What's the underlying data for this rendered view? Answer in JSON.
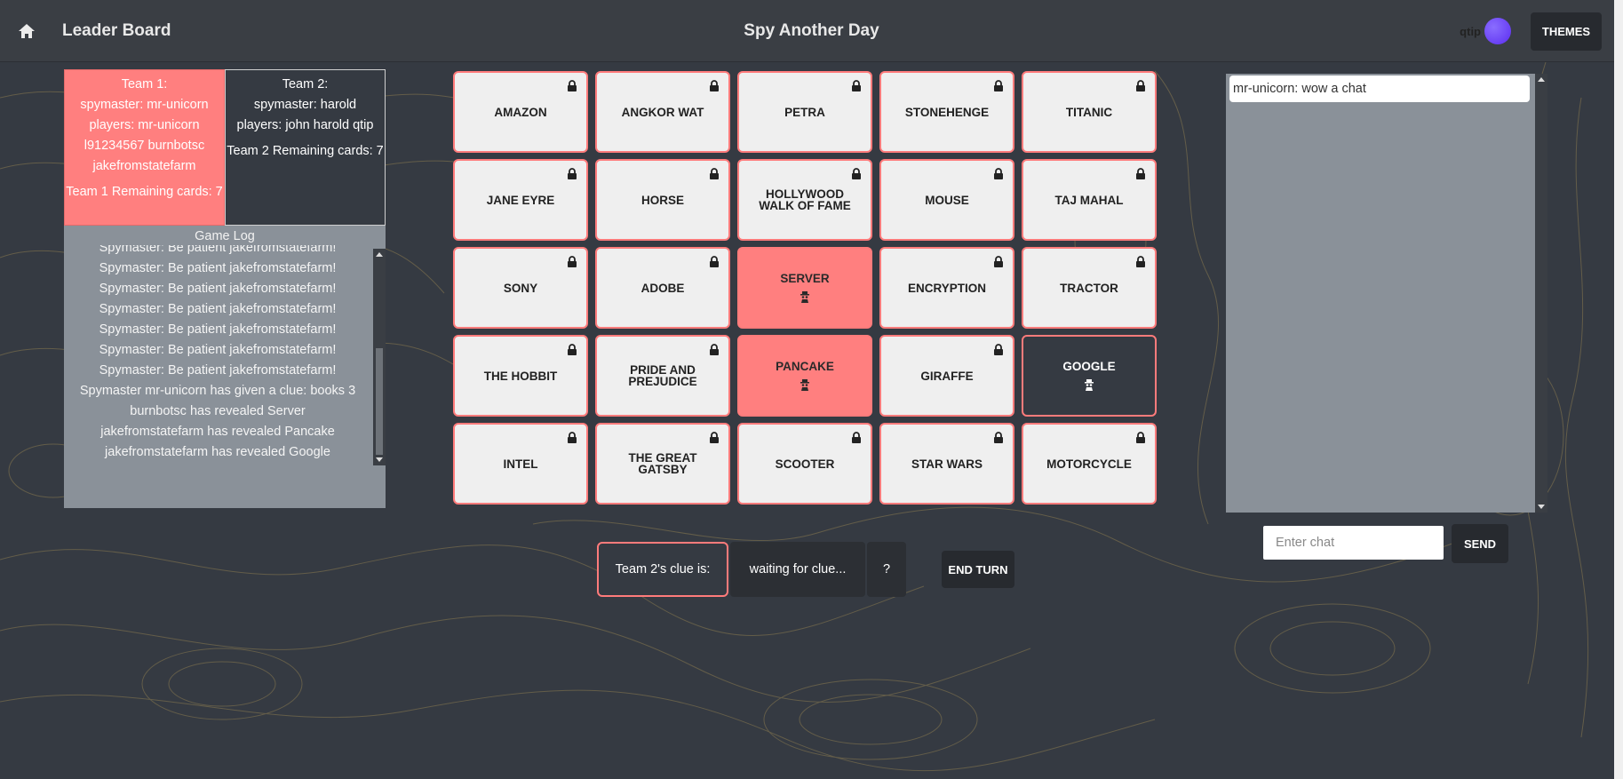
{
  "header": {
    "leader_board": "Leader Board",
    "title": "Spy Another Day",
    "username": "qtip",
    "themes_label": "THEMES"
  },
  "teams": {
    "team1": {
      "name": "Team 1:",
      "spymaster": "spymaster: mr-unicorn",
      "players": "players: mr-unicorn l91234567  burnbotsc jakefromstatefarm",
      "remaining": "Team 1 Remaining cards: 7"
    },
    "team2": {
      "name": "Team 2:",
      "spymaster": "spymaster: harold",
      "players": "players: john  harold qtip",
      "remaining": "Team 2 Remaining cards: 7"
    }
  },
  "game_log": {
    "title": "Game Log",
    "entries": [
      "Spymaster: Be patient jakefromstatefarm!",
      "Spymaster: Be patient jakefromstatefarm!",
      "Spymaster: Be patient jakefromstatefarm!",
      "Spymaster: Be patient jakefromstatefarm!",
      "Spymaster: Be patient jakefromstatefarm!",
      "Spymaster: Be patient jakefromstatefarm!",
      "Spymaster: Be patient jakefromstatefarm!",
      "Spymaster mr-unicorn has given a clue: books 3",
      "burnbotsc has revealed Server",
      "jakefromstatefarm has revealed Pancake",
      "jakefromstatefarm has revealed Google"
    ]
  },
  "board": {
    "cards": [
      {
        "word": "AMAZON",
        "state": "hidden"
      },
      {
        "word": "ANGKOR WAT",
        "state": "hidden"
      },
      {
        "word": "PETRA",
        "state": "hidden"
      },
      {
        "word": "STONEHENGE",
        "state": "hidden"
      },
      {
        "word": "TITANIC",
        "state": "hidden"
      },
      {
        "word": "JANE EYRE",
        "state": "hidden"
      },
      {
        "word": "HORSE",
        "state": "hidden"
      },
      {
        "word": "HOLLYWOOD WALK OF FAME",
        "state": "hidden"
      },
      {
        "word": "MOUSE",
        "state": "hidden"
      },
      {
        "word": "TAJ MAHAL",
        "state": "hidden"
      },
      {
        "word": "SONY",
        "state": "hidden"
      },
      {
        "word": "ADOBE",
        "state": "hidden"
      },
      {
        "word": "SERVER",
        "state": "red"
      },
      {
        "word": "ENCRYPTION",
        "state": "hidden"
      },
      {
        "word": "TRACTOR",
        "state": "hidden"
      },
      {
        "word": "THE HOBBIT",
        "state": "hidden"
      },
      {
        "word": "PRIDE AND PREJUDICE",
        "state": "hidden"
      },
      {
        "word": "PANCAKE",
        "state": "red"
      },
      {
        "word": "GIRAFFE",
        "state": "hidden"
      },
      {
        "word": "GOOGLE",
        "state": "blue"
      },
      {
        "word": "INTEL",
        "state": "hidden"
      },
      {
        "word": "THE GREAT GATSBY",
        "state": "hidden"
      },
      {
        "word": "SCOOTER",
        "state": "hidden"
      },
      {
        "word": "STAR WARS",
        "state": "hidden"
      },
      {
        "word": "MOTORCYCLE",
        "state": "hidden"
      }
    ]
  },
  "clue": {
    "label": "Team 2's clue is:",
    "value": "waiting for clue...",
    "number": "?",
    "end_turn": "END TURN"
  },
  "chat": {
    "messages": [
      "mr-unicorn: wow a chat"
    ],
    "placeholder": "Enter chat",
    "send_label": "SEND"
  },
  "colors": {
    "team1": "#ff7f7f",
    "team2": "#353a42",
    "card": "#efefef",
    "panel": "#8a9199"
  },
  "icons": {
    "home": "home-icon",
    "lock": "lock-icon",
    "spy": "spy-icon"
  }
}
